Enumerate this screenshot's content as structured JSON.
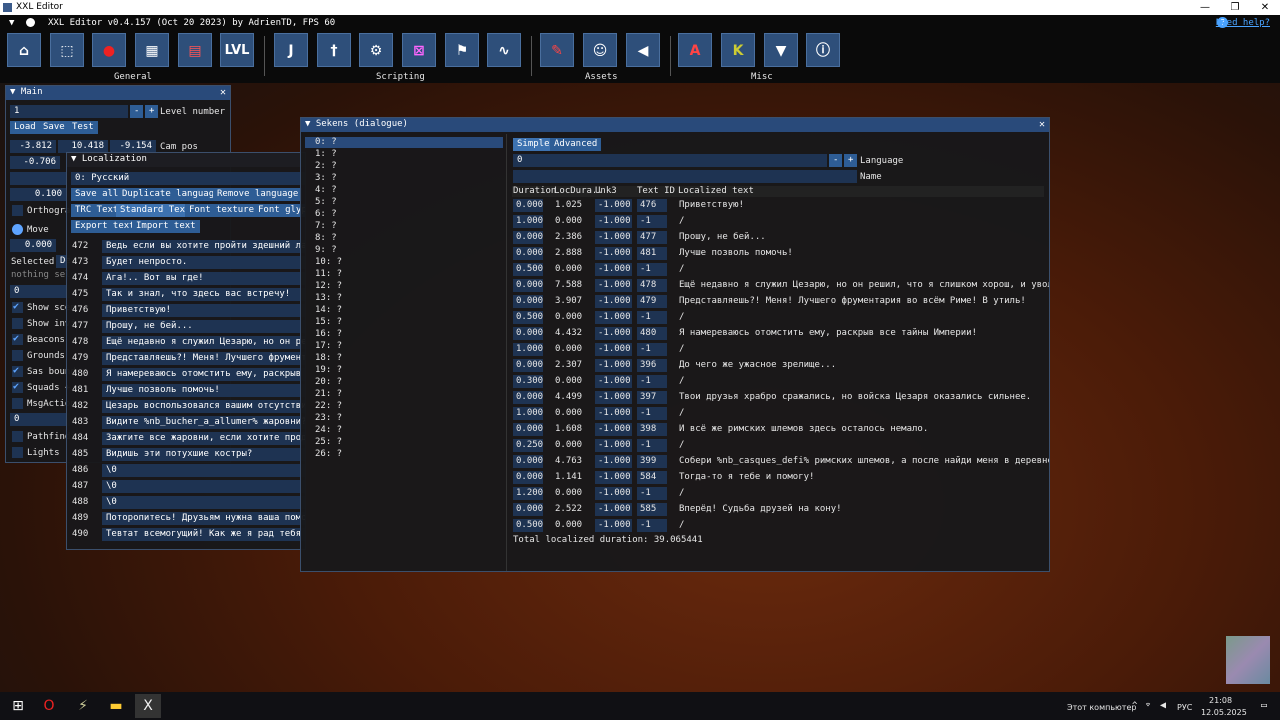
{
  "os_window": {
    "title": "XXL Editor",
    "minimize": "—",
    "maximize": "❐",
    "close": "✕"
  },
  "menubar": {
    "title": "XXL Editor v0.4.157 (Oct 20 2023) by AdrienTD, FPS 60",
    "help": "Need help?"
  },
  "toolbar": {
    "groups": [
      "General",
      "Scripting",
      "Assets",
      "Misc"
    ],
    "lvl_label": "LVL"
  },
  "main_panel": {
    "title": "Main",
    "level_value": "1",
    "level_label": "Level number",
    "buttons": [
      "Load",
      "Save",
      "Test"
    ],
    "cam_pos": [
      "-3.812",
      "10.418",
      "-9.154"
    ],
    "cam_label": "Cam pos",
    "partial_value_1": "-0.706",
    "partial_value_2": "0.100",
    "orthographic": "Orthograp",
    "move_label": "Move",
    "move_value": "0.000",
    "selected_label": "Selected:",
    "selected_value": "De",
    "nothing_selected": "nothing sele",
    "zero_field": "0",
    "checkboxes": [
      {
        "label": "Show scen",
        "checked": true
      },
      {
        "label": "Show invi",
        "checked": false
      },
      {
        "label": "Beacons",
        "checked": true
      },
      {
        "label": "Grounds",
        "checked": false
      },
      {
        "label": "Sas bound",
        "checked": true
      },
      {
        "label": "Squads +",
        "checked": true
      },
      {
        "label": "MsgAction",
        "checked": false
      }
    ],
    "zero_field_2": "0",
    "checkboxes_2": [
      {
        "label": "Pathfindi",
        "checked": false
      },
      {
        "label": "Lights",
        "checked": false
      }
    ]
  },
  "localization_panel": {
    "title": "Localization",
    "language": "0: Русский",
    "buttons_row1": [
      "Save all",
      "Duplicate language",
      "Remove language"
    ],
    "buttons_row2": [
      "TRC Text",
      "Standard Text",
      "Font textures",
      "Font glyp"
    ],
    "buttons_row3": [
      "Export text",
      "Import text"
    ],
    "rows": [
      {
        "id": "472",
        "text": "Ведь если вы хотите пройти здешний лабиринт"
      },
      {
        "id": "473",
        "text": "Будет непросто."
      },
      {
        "id": "474",
        "text": "Ага!.. Вот вы где!"
      },
      {
        "id": "475",
        "text": "Так и знал, что здесь вас встречу!"
      },
      {
        "id": "476",
        "text": "Приветствую!"
      },
      {
        "id": "477",
        "text": "Прошу, не бей..."
      },
      {
        "id": "478",
        "text": "Ещё недавно я служил Цезарю, но он решил, что"
      },
      {
        "id": "479",
        "text": "Представляешь?! Меня! Лучшего фрументария"
      },
      {
        "id": "480",
        "text": "Я намереваюсь отомстить ему, раскрыв все тайны"
      },
      {
        "id": "481",
        "text": "Лучше позволь помочь!"
      },
      {
        "id": "482",
        "text": "Цезарь воспользовался вашим отсутствием.."
      },
      {
        "id": "483",
        "text": "Видите %nb_bucher_a_allumer% жаровни?"
      },
      {
        "id": "484",
        "text": "Зажгите все жаровни, если хотите продолжить"
      },
      {
        "id": "485",
        "text": "Видишь эти потухшие костры?"
      },
      {
        "id": "486",
        "text": "\\0"
      },
      {
        "id": "487",
        "text": "\\0"
      },
      {
        "id": "488",
        "text": "\\0"
      },
      {
        "id": "489",
        "text": "Поторопитесь! Друзьям нужна ваша помощь!"
      },
      {
        "id": "490",
        "text": "Тевтат всемогущий! Как же я рад тебя видеть"
      }
    ]
  },
  "sekens_panel": {
    "title": "Sekens (dialogue)",
    "list": [
      "0: ?",
      "1: ?",
      "2: ?",
      "3: ?",
      "4: ?",
      "5: ?",
      "6: ?",
      "7: ?",
      "8: ?",
      "9: ?",
      "10: ?",
      "11: ?",
      "12: ?",
      "13: ?",
      "14: ?",
      "15: ?",
      "16: ?",
      "17: ?",
      "18: ?",
      "19: ?",
      "20: ?",
      "21: ?",
      "22: ?",
      "23: ?",
      "24: ?",
      "25: ?",
      "26: ?"
    ],
    "tabs": [
      "Simple",
      "Advanced"
    ],
    "language_value": "0",
    "language_label": "Language",
    "name_label": "Name",
    "columns": [
      "Duration",
      "LocDura..",
      "Unk3",
      "Text ID",
      "Localized text"
    ],
    "rows": [
      {
        "d": "0.000",
        "ld": "1.025",
        "u": "-1.000",
        "id": "476",
        "t": "Приветствую!"
      },
      {
        "d": "1.000",
        "ld": "0.000",
        "u": "-1.000",
        "id": "-1",
        "t": "/"
      },
      {
        "d": "0.000",
        "ld": "2.386",
        "u": "-1.000",
        "id": "477",
        "t": "Прошу, не бей..."
      },
      {
        "d": "0.000",
        "ld": "2.888",
        "u": "-1.000",
        "id": "481",
        "t": "Лучше позволь помочь!"
      },
      {
        "d": "0.500",
        "ld": "0.000",
        "u": "-1.000",
        "id": "-1",
        "t": "/"
      },
      {
        "d": "0.000",
        "ld": "7.588",
        "u": "-1.000",
        "id": "478",
        "t": "Ещё недавно я служил Цезарю, но он решил, что я слишком хорош, и уволил меня!"
      },
      {
        "d": "0.000",
        "ld": "3.907",
        "u": "-1.000",
        "id": "479",
        "t": "Представляешь?! Меня! Лучшего фрументария во всём Риме! В утиль!"
      },
      {
        "d": "0.500",
        "ld": "0.000",
        "u": "-1.000",
        "id": "-1",
        "t": "/"
      },
      {
        "d": "0.000",
        "ld": "4.432",
        "u": "-1.000",
        "id": "480",
        "t": "Я намереваюсь отомстить ему, раскрыв все тайны Империи!"
      },
      {
        "d": "1.000",
        "ld": "0.000",
        "u": "-1.000",
        "id": "-1",
        "t": "/"
      },
      {
        "d": "0.000",
        "ld": "2.307",
        "u": "-1.000",
        "id": "396",
        "t": "До чего же ужасное зрелище..."
      },
      {
        "d": "0.300",
        "ld": "0.000",
        "u": "-1.000",
        "id": "-1",
        "t": "/"
      },
      {
        "d": "0.000",
        "ld": "4.499",
        "u": "-1.000",
        "id": "397",
        "t": "Твои друзья храбро сражались, но войска Цезаря оказались сильнее."
      },
      {
        "d": "1.000",
        "ld": "0.000",
        "u": "-1.000",
        "id": "-1",
        "t": "/"
      },
      {
        "d": "0.000",
        "ld": "1.608",
        "u": "-1.000",
        "id": "398",
        "t": "И всё же римских шлемов здесь осталось немало."
      },
      {
        "d": "0.250",
        "ld": "0.000",
        "u": "-1.000",
        "id": "-1",
        "t": "/"
      },
      {
        "d": "0.000",
        "ld": "4.763",
        "u": "-1.000",
        "id": "399",
        "t": "Собери %nb_casques_defi% римских шлемов, а после найди меня в деревне у больших"
      },
      {
        "d": "0.000",
        "ld": "1.141",
        "u": "-1.000",
        "id": "584",
        "t": "Тогда-то я тебе и помогу!"
      },
      {
        "d": "1.200",
        "ld": "0.000",
        "u": "-1.000",
        "id": "-1",
        "t": "/"
      },
      {
        "d": "0.000",
        "ld": "2.522",
        "u": "-1.000",
        "id": "585",
        "t": "Вперёд! Судьба друзей на кону!"
      },
      {
        "d": "0.500",
        "ld": "0.000",
        "u": "-1.000",
        "id": "-1",
        "t": "/"
      }
    ],
    "total": "Total localized duration: 39.065441"
  },
  "taskbar": {
    "computer_label": "Этот компьютер",
    "lang": "РУС",
    "time": "21:08",
    "date": "12.05.2025"
  },
  "colors": {
    "accent": "#294a7a",
    "button": "#2e5d95",
    "field": "#1e3352",
    "link": "#4aa3ff"
  }
}
